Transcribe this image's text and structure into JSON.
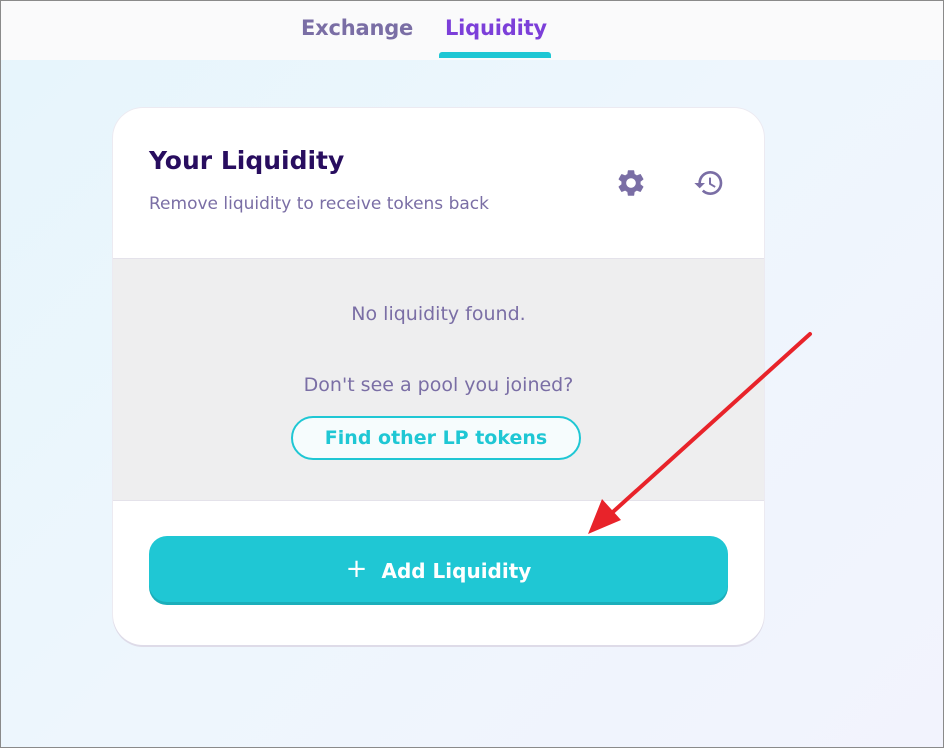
{
  "nav": {
    "tabs": [
      {
        "label": "Exchange",
        "active": false
      },
      {
        "label": "Liquidity",
        "active": true
      }
    ]
  },
  "card": {
    "title": "Your Liquidity",
    "subtitle": "Remove liquidity to receive tokens back",
    "icons": [
      "gear-icon",
      "history-icon"
    ],
    "empty_message": "No liquidity found.",
    "prompt": "Don't see a pool you joined?",
    "find_button": "Find other LP tokens",
    "add_button": {
      "icon": "+",
      "label": "Add Liquidity"
    }
  },
  "colors": {
    "accent": "#1fc7d4",
    "title": "#280d5f",
    "secondary": "#7a6ea5",
    "active_tab": "#7c3fd9",
    "annotation_arrow": "#e8232a"
  }
}
